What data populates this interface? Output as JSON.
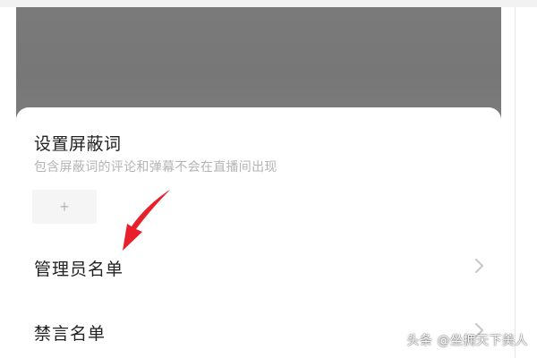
{
  "filter_words": {
    "title": "设置屏蔽词",
    "description": "包含屏蔽词的评论和弹幕不会在直播间出现",
    "add_label": "+"
  },
  "menu": {
    "admin_list": "管理员名单",
    "mute_list": "禁言名单"
  },
  "annotation": {
    "arrow_color": "#e8202a"
  },
  "watermark": "头条 @坐拥天下美人",
  "colors": {
    "overlay": "#7a7a7a",
    "title_text": "#222222",
    "hint_text": "#b4b4b4",
    "chevron": "#c8c8c8"
  }
}
